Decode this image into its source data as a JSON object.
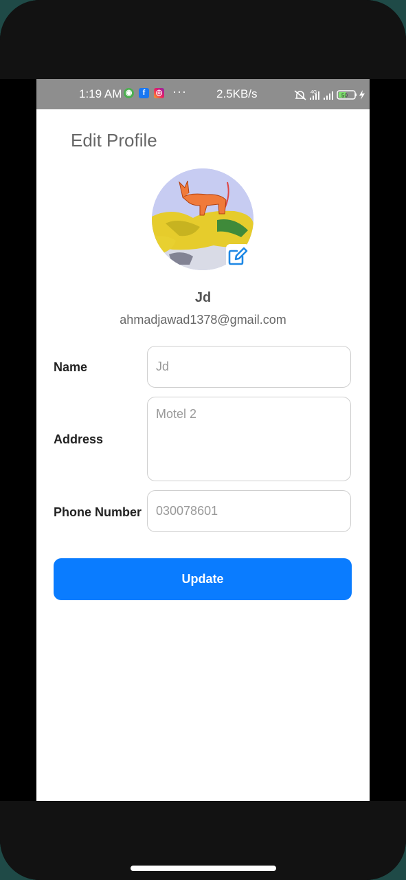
{
  "status_bar": {
    "time": "1:19 AM",
    "more": "···",
    "net_speed": "2.5KB/s",
    "network_type": "4G",
    "battery": "50"
  },
  "page": {
    "title": "Edit Profile"
  },
  "profile": {
    "name": "Jd",
    "email": "ahmadjawad1378@gmail.com"
  },
  "form": {
    "name_label": "Name",
    "name_placeholder": "Jd",
    "address_label": "Address",
    "address_placeholder": "Motel 2",
    "phone_label": "Phone Number",
    "phone_placeholder": "030078601",
    "submit_label": "Update"
  },
  "icons": {
    "edit": "edit-pencil-icon",
    "facebook": "facebook-icon",
    "instagram": "instagram-icon",
    "silent": "bell-off-icon",
    "signal": "signal-icon",
    "battery": "battery-icon",
    "charging": "bolt-icon"
  },
  "colors": {
    "primary": "#0a7cff",
    "status_bar": "#8e8e8e",
    "edit_icon": "#1e88e5"
  }
}
